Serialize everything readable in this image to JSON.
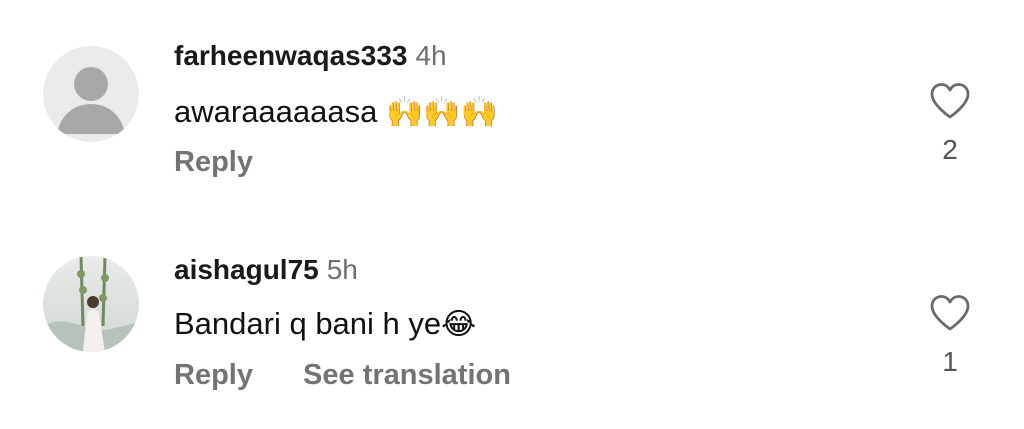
{
  "comments": [
    {
      "username": "farheenwaqas333",
      "time": "4h",
      "text": "awaraaaaaasa",
      "emoji": "🙌🙌🙌",
      "reply_label": "Reply",
      "likes": "2",
      "avatar": "default-avatar"
    },
    {
      "username": "aishagul75",
      "time": "5h",
      "text": "Bandari q bani h ye",
      "emoji": "😂",
      "reply_label": "Reply",
      "translate_label": "See translation",
      "likes": "1",
      "avatar": "photo-avatar"
    }
  ],
  "icons": {
    "like": "heart-outline-icon"
  },
  "colors": {
    "text": "#111111",
    "muted": "#737373",
    "avatar_bg": "#eaeaea",
    "avatar_fg": "#a9a9a9"
  }
}
